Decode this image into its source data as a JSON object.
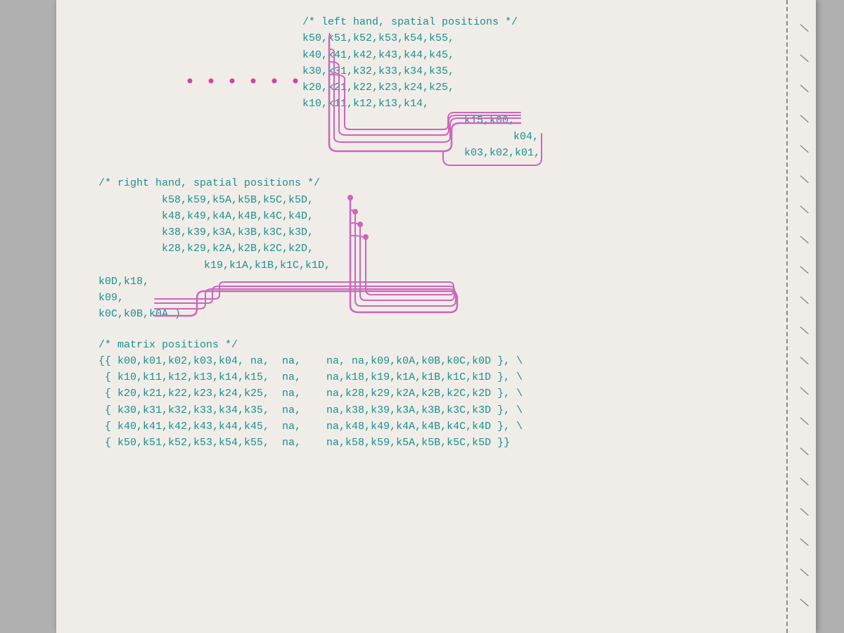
{
  "page": {
    "background": "#f0ede8"
  },
  "left_hand_section": {
    "comment": "/* left hand, spatial positions */",
    "lines": [
      "k50,k51,k52,k53,k54,k55,",
      "k40,k41,k42,k43,k44,k45,",
      "k30,k31,k32,k33,k34,k35,",
      "k20,k21,k22,k23,k24,k25,",
      "k10,k11,k12,k13,k14,",
      "                              k15,k00,",
      "                                   k04,",
      "                              k03,k02,k01,"
    ]
  },
  "right_hand_section": {
    "comment": "/* right hand, spatial positions */",
    "lines": [
      "        k58,k59,k5A,k5B,k5C,k5D,",
      "        k48,k49,k4A,k4B,k4C,k4D,",
      "        k38,k39,k3A,k3B,k3C,k3D,",
      "        k28,k29,k2A,k2B,k2C,k2D,",
      "             k19,k1A,k1B,k1C,k1D,",
      "k0D,k18,",
      "k09,",
      "k0C,k0B,k0A )"
    ]
  },
  "matrix_section": {
    "comment": "/* matrix positions */",
    "lines": [
      "{{ k00,k01,k02,k03,k04, na,  na,    na, na,k09,k0A,k0B,k0C,k0D },",
      " { k10,k11,k12,k13,k14,k15,  na,    na,k18,k19,k1A,k1B,k1C,k1D },",
      " { k20,k21,k22,k23,k24,k25,  na,    na,k28,k29,k2A,k2B,k2C,k2D },",
      " { k30,k31,k32,k33,k34,k35,  na,    na,k38,k39,k3A,k3B,k3C,k3D },",
      " { k40,k41,k42,k43,k44,k45,  na,    na,k48,k49,k4A,k4B,k4C,k4D },",
      " { k50,k51,k52,k53,k54,k55,  na,    na,k58,k59,k5A,k5B,k5C,k5D }}"
    ]
  },
  "slash_marks": [
    "\\",
    "\\",
    "\\",
    "\\",
    "\\",
    "\\",
    "\\",
    "\\",
    "\\",
    "\\",
    "\\",
    "\\",
    "\\",
    "\\",
    "\\",
    "\\",
    "\\",
    "\\",
    "\\",
    "\\"
  ]
}
